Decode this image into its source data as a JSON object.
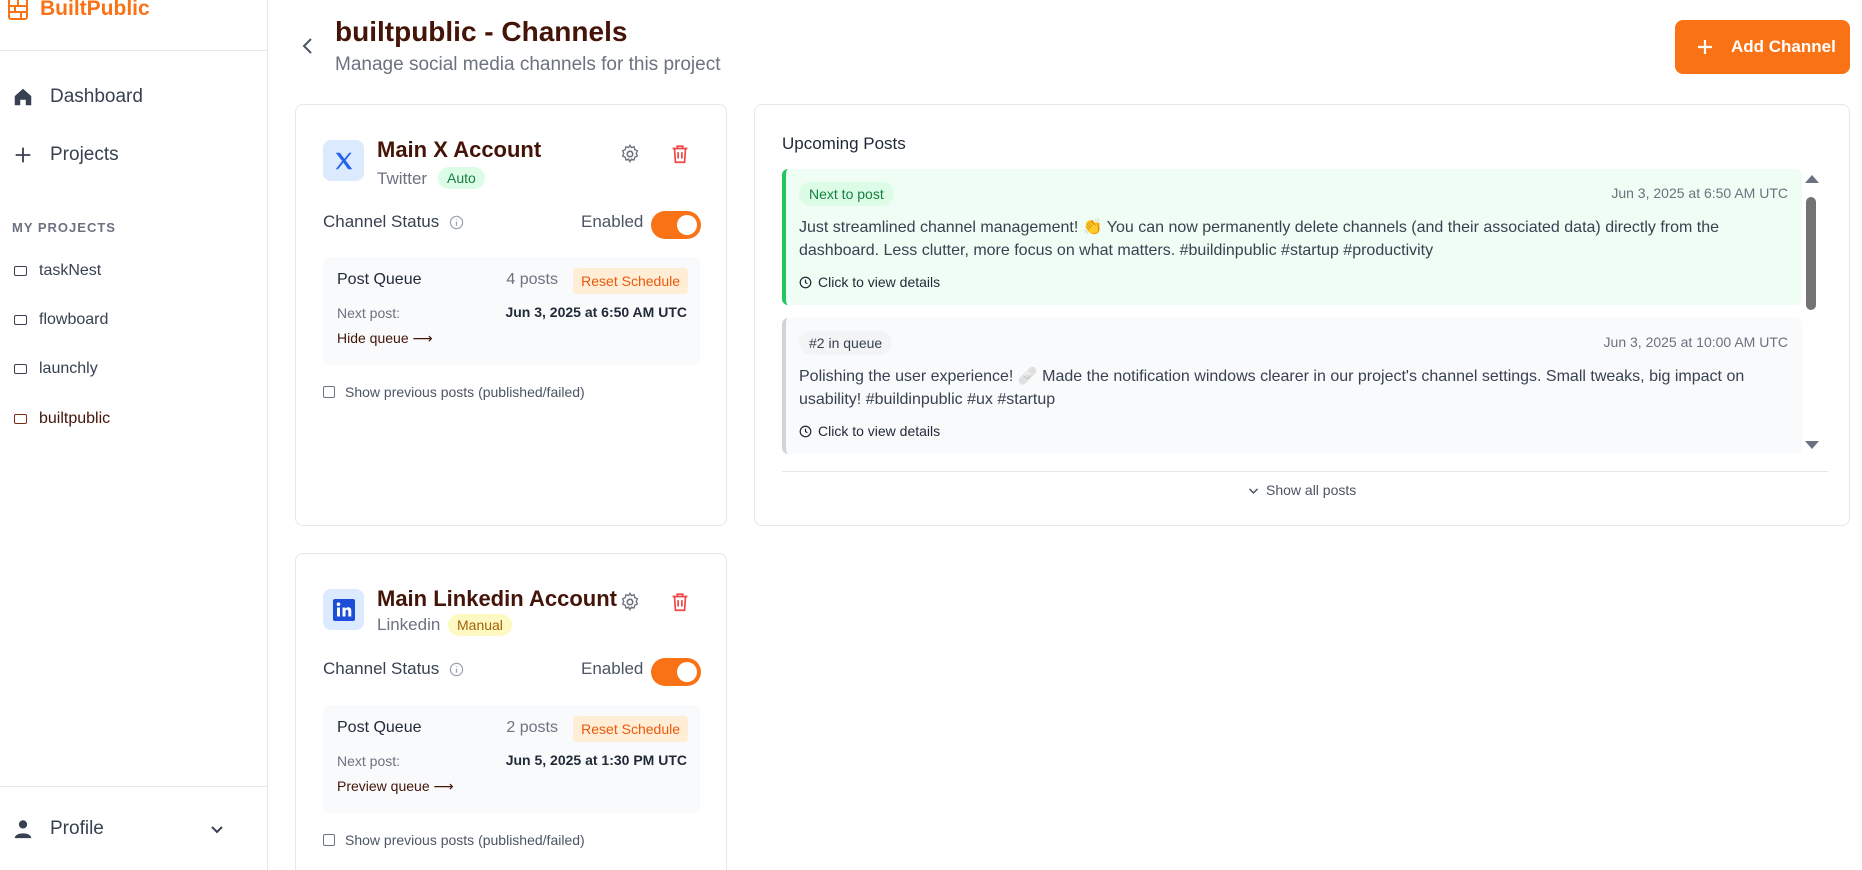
{
  "brand": {
    "name": "BuiltPublic"
  },
  "nav": {
    "dashboard": "Dashboard",
    "projects": "Projects"
  },
  "my_projects": {
    "label": "MY PROJECTS",
    "items": [
      "taskNest",
      "flowboard",
      "launchly",
      "builtpublic"
    ],
    "active": "builtpublic"
  },
  "profile": {
    "label": "Profile"
  },
  "header": {
    "title": "builtpublic - Channels",
    "subtitle": "Manage social media channels for this project",
    "add_button": "Add Channel"
  },
  "channels": [
    {
      "name": "Main X Account",
      "platform": "Twitter",
      "mode": "Auto",
      "status_label": "Channel Status",
      "enabled_label": "Enabled",
      "enabled": true,
      "queue_title": "Post Queue",
      "queue_count": "4 posts",
      "reset_label": "Reset Schedule",
      "next_label": "Next post:",
      "next_value": "Jun 3, 2025 at 6:50 AM UTC",
      "queue_link": "Hide queue ⟶",
      "show_previous": "Show previous posts (published/failed)"
    },
    {
      "name": "Main Linkedin Account",
      "platform": "Linkedin",
      "mode": "Manual",
      "status_label": "Channel Status",
      "enabled_label": "Enabled",
      "enabled": true,
      "queue_title": "Post Queue",
      "queue_count": "2 posts",
      "reset_label": "Reset Schedule",
      "next_label": "Next post:",
      "next_value": "Jun 5, 2025 at 1:30 PM UTC",
      "queue_link": "Preview queue ⟶",
      "show_previous": "Show previous posts (published/failed)"
    }
  ],
  "upcoming": {
    "title": "Upcoming Posts",
    "posts": [
      {
        "tag": "Next to post",
        "date": "Jun 3, 2025 at 6:50 AM UTC",
        "body": "Just streamlined channel management! 👏 You can now permanently delete channels (and their associated data) directly from the dashboard. Less clutter, more focus on what matters. #buildinpublic #startup #productivity",
        "details": "Click to view details"
      },
      {
        "tag": "#2 in queue",
        "date": "Jun 3, 2025 at 10:00 AM UTC",
        "body": "Polishing the user experience! 🩹 Made the notification windows clearer in our project's channel settings. Small tweaks, big impact on usability! #buildinpublic #ux #startup",
        "details": "Click to view details"
      }
    ],
    "show_all": "Show all posts"
  },
  "colors": {
    "accent": "#f97316",
    "title": "#431407",
    "success": "#22c55e"
  }
}
